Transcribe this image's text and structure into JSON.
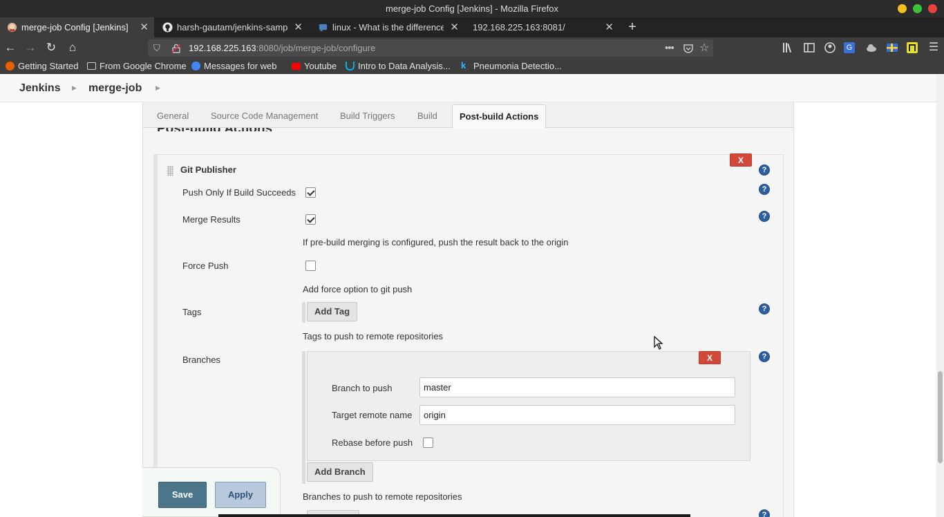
{
  "window": {
    "title": "merge-job Config [Jenkins] - Mozilla Firefox"
  },
  "browser": {
    "tabs": [
      {
        "label": "merge-job Config [Jenkins]",
        "active": true,
        "icon": "jenkins-icon"
      },
      {
        "label": "harsh-gautam/jenkins-sampl",
        "active": false,
        "icon": "github-icon"
      },
      {
        "label": "linux - What is the difference",
        "active": false,
        "icon": "stackexchange-icon"
      },
      {
        "label": "192.168.225.163:8081/",
        "active": false,
        "icon": ""
      }
    ],
    "url": {
      "host": "192.168.225.163",
      "rest": ":8080/job/merge-job/configure"
    },
    "bookmarks": [
      {
        "label": "Getting Started",
        "icon": "firefox-icon",
        "color": "#e66000"
      },
      {
        "label": "From Google Chrome",
        "icon": "folder-icon",
        "color": "#cfcfcf"
      },
      {
        "label": "Messages for web",
        "icon": "messages-icon",
        "color": "#4285f4"
      },
      {
        "label": "Youtube",
        "icon": "youtube-icon",
        "color": "#ff0000"
      },
      {
        "label": "Intro to Data Analysis...",
        "icon": "udacity-icon",
        "color": "#02b3e4"
      },
      {
        "label": "Pneumonia Detectio...",
        "icon": "kaggle-icon",
        "color": "#20beff"
      }
    ]
  },
  "jenkins": {
    "breadcrumbs": [
      "Jenkins",
      "merge-job"
    ]
  },
  "config": {
    "tabs": [
      "General",
      "Source Code Management",
      "Build Triggers",
      "Build",
      "Post-build Actions"
    ],
    "active_tab": "Post-build Actions",
    "section_title": "Post-build Actions",
    "publisher": {
      "title": "Git Publisher",
      "delete_label": "X",
      "push_only_if_success": {
        "label": "Push Only If Build Succeeds",
        "checked": true
      },
      "merge_results": {
        "label": "Merge Results",
        "checked": true,
        "description": "If pre-build merging is configured, push the result back to the origin"
      },
      "force_push": {
        "label": "Force Push",
        "checked": false,
        "description": "Add force option to git push"
      },
      "tags": {
        "label": "Tags",
        "button": "Add Tag",
        "description": "Tags to push to remote repositories"
      },
      "branches": {
        "label": "Branches",
        "delete_label": "X",
        "branch_to_push_label": "Branch to push",
        "branch_to_push_value": "master",
        "target_remote_label": "Target remote name",
        "target_remote_value": "origin",
        "rebase_label": "Rebase before push",
        "rebase_checked": false,
        "add_button": "Add Branch",
        "description": "Branches to push to remote repositories"
      },
      "help_glyph": "?"
    },
    "actions": {
      "save": "Save",
      "apply": "Apply"
    }
  }
}
